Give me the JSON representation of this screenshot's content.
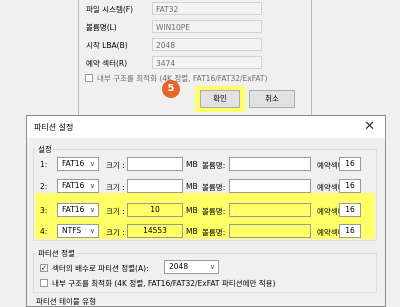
{
  "top_dialog": {
    "fs_label": "파일 시스템(F)",
    "fs_value": "FAT32",
    "volume_label": "볼륨명(L)",
    "volume_value": "WIN10PE",
    "lba_label": "시작 LBA(B)",
    "lba_value": "2048",
    "reserved_label": "예약 섹터(R)",
    "reserved_value": "3474",
    "optimize_label": "내부 구조를 최적화 (4K 정렬, FAT16/FAT32/ExFAT)",
    "ok_label": "확인",
    "cancel_label": "취소",
    "step_badge": "5"
  },
  "dialog": {
    "title": "파티션 설정",
    "close": "✕",
    "settings_group": "설정",
    "size_label": "크기 :",
    "mb_label": "MB",
    "volume_label": "볼륨명:",
    "reserved_label": "예약섹터:",
    "rows": [
      {
        "num": "1:",
        "fs": "FAT16",
        "size": "",
        "volume": "",
        "reserved": "16"
      },
      {
        "num": "2:",
        "fs": "FAT16",
        "size": "",
        "volume": "",
        "reserved": "16"
      },
      {
        "num": "3:",
        "fs": "FAT16",
        "size": "10",
        "volume": "",
        "reserved": "16"
      },
      {
        "num": "4:",
        "fs": "NTFS",
        "size": "14553",
        "volume": "",
        "reserved": "16"
      }
    ],
    "align_group": "파티션 정렬",
    "align_label": "섹터의 배수로 파티션 정렬(A):",
    "align_value": "2048",
    "optimize_label": "내부 구조를 최적화 (4K 정렬, FAT16/FAT32/ExFAT 파티션에만 적용)",
    "bottom_label": "파티션 테이블 유형"
  },
  "colors": {
    "highlight": "#ffff66",
    "badge": "#e8642a"
  }
}
